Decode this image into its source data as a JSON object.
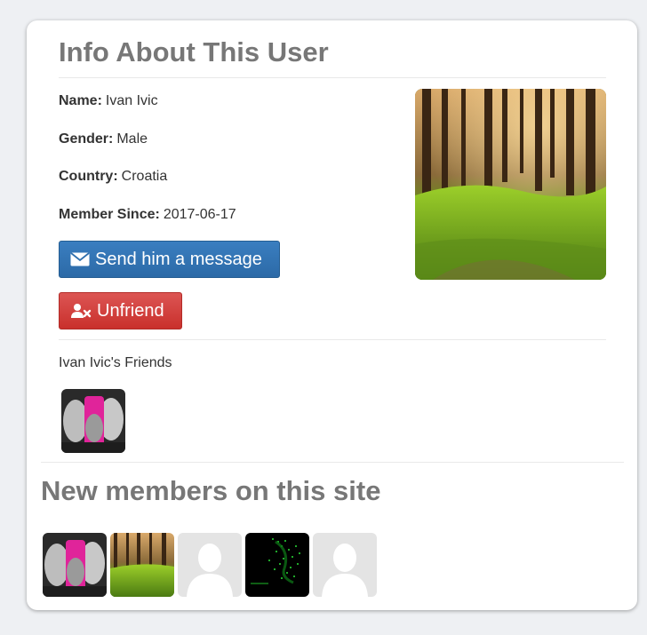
{
  "profile": {
    "title": "Info About This User",
    "fields": [
      {
        "label": "Name:",
        "value": "Ivan Ivic"
      },
      {
        "label": "Gender:",
        "value": "Male"
      },
      {
        "label": "Country:",
        "value": "Croatia"
      },
      {
        "label": "Member Since:",
        "value": "2017-06-17"
      }
    ],
    "message_button": "Send him a message",
    "unfriend_button": "Unfriend",
    "friends_label": "Ivan Ivic's Friends",
    "photo_alt": "forest"
  },
  "new_members": {
    "title": "New members on this site",
    "thumbs": [
      "band-photo",
      "forest-photo",
      "default-avatar",
      "green-code-photo",
      "default-avatar"
    ]
  },
  "icons": {
    "message": "envelope-icon",
    "unfriend": "user-remove-icon"
  },
  "colors": {
    "primary": "#337ab7",
    "danger": "#d9534f",
    "heading": "#777777"
  }
}
